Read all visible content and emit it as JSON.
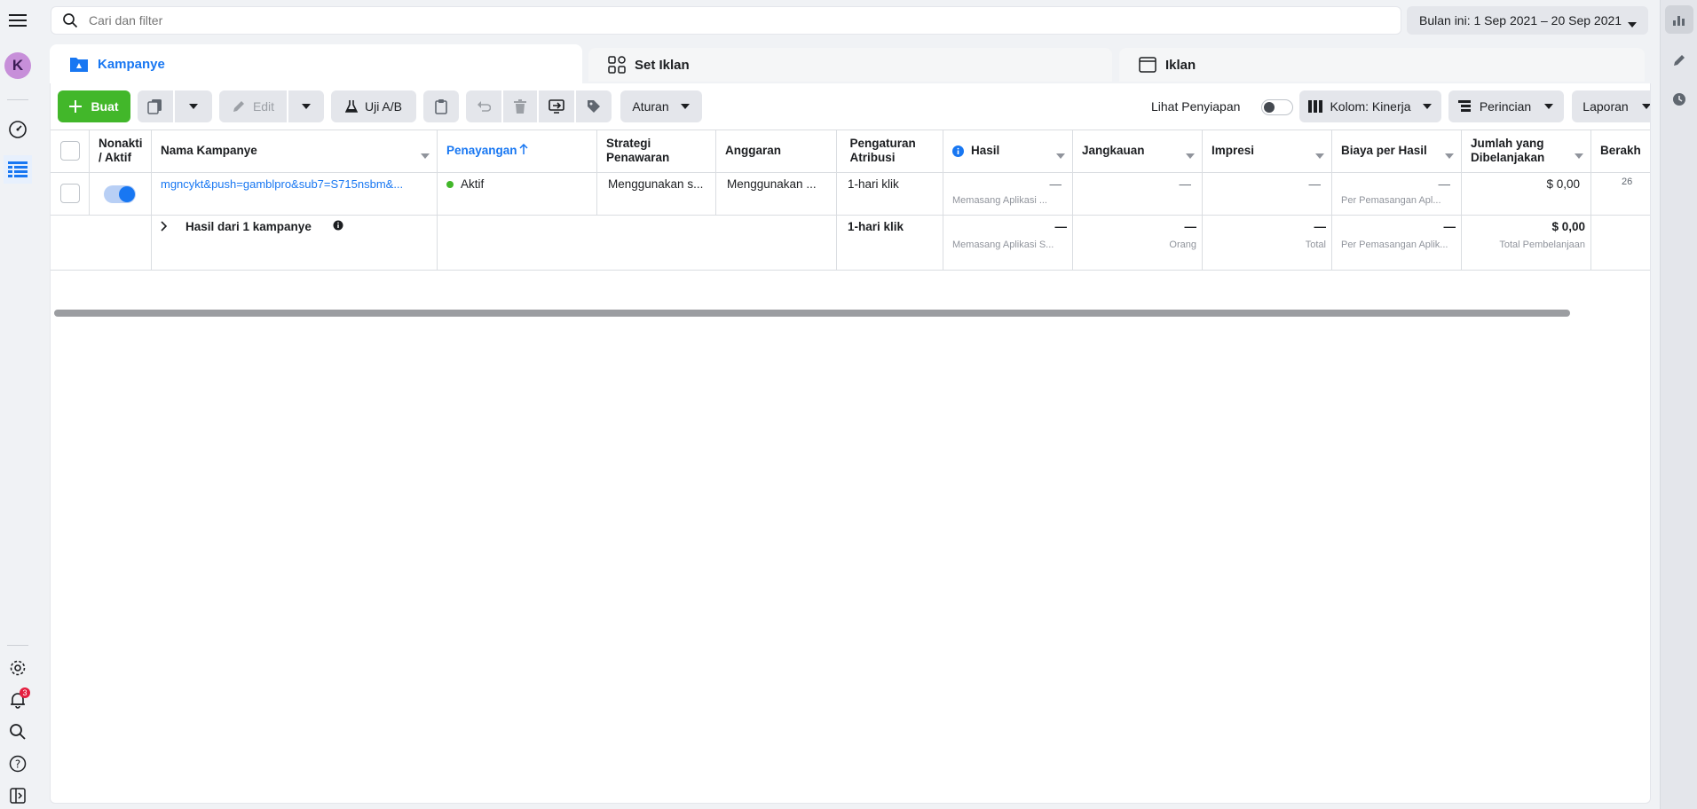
{
  "nav": {
    "avatar_letter": "K",
    "notif_count": "3"
  },
  "search": {
    "placeholder": "Cari dan filter"
  },
  "date_range": {
    "label": "Bulan ini: 1 Sep 2021 – 20 Sep 2021"
  },
  "tabs": [
    {
      "label": "Kampanye"
    },
    {
      "label": "Set Iklan"
    },
    {
      "label": "Iklan"
    }
  ],
  "toolbar": {
    "create": "Buat",
    "edit": "Edit",
    "ab_test": "Uji A/B",
    "rules": "Aturan",
    "view_setup": "Lihat Penyiapan",
    "columns": "Kolom: Kinerja",
    "breakdown": "Perincian",
    "reports": "Laporan"
  },
  "columns": {
    "off_on": "Nonakti / Aktif",
    "name": "Nama Kampanye",
    "delivery": "Penayangan",
    "bid_strategy": "Strategi Penawaran",
    "budget": "Anggaran",
    "attribution": "Pengaturan Atribusi",
    "results": "Hasil",
    "reach": "Jangkauan",
    "impressions": "Impresi",
    "cost_per_result": "Biaya per Hasil",
    "amount_spent": "Jumlah yang Dibelanjakan",
    "ends": "Berakh"
  },
  "rows": [
    {
      "name": "mgncykt&push=gamblpro&sub7=S715nsbm&...",
      "delivery": "Aktif",
      "bid_strategy": "Menggunakan s...",
      "budget": "Menggunakan ...",
      "attribution": "1-hari klik",
      "results": "—",
      "results_sub": "Memasang Aplikasi ...",
      "reach": "—",
      "impressions": "—",
      "cost_per_result": "—",
      "cost_per_result_sub": "Per Pemasangan Apl...",
      "amount_spent": "$ 0,00",
      "ends": "26"
    }
  ],
  "summary": {
    "label": "Hasil dari 1 kampanye",
    "attribution": "1-hari klik",
    "results": "—",
    "results_sub": "Memasang Aplikasi S...",
    "reach": "—",
    "reach_sub": "Orang",
    "impressions": "—",
    "impressions_sub": "Total",
    "cost_per_result": "—",
    "cost_per_result_sub": "Per Pemasangan Aplik...",
    "amount_spent": "$ 0,00",
    "amount_spent_sub": "Total Pembelanjaan"
  },
  "colors": {
    "accent": "#1877f2",
    "create_green": "#42b72a",
    "active_dot": "#42b72a",
    "avatar": "#c78fd9",
    "badge": "#e41e3f"
  }
}
